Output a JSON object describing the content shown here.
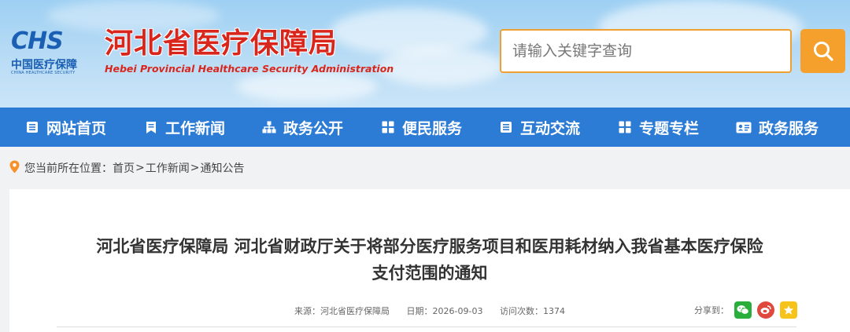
{
  "header": {
    "logo_letters": "CHS",
    "logo_cn": "中国医疗保障",
    "logo_en": "CHINA HEALTHCARE SECURITY",
    "site_title": "河北省医疗保障局",
    "site_subtitle": "Hebei Provincial Healthcare Security Administration",
    "search_placeholder": "请输入关键字查询",
    "search_icon": "search-icon"
  },
  "nav": {
    "items": [
      {
        "label": "网站首页",
        "icon": "list-icon"
      },
      {
        "label": "工作新闻",
        "icon": "bookmark-icon"
      },
      {
        "label": "政务公开",
        "icon": "org-chart-icon"
      },
      {
        "label": "便民服务",
        "icon": "grid-icon"
      },
      {
        "label": "互动交流",
        "icon": "list-icon"
      },
      {
        "label": "专题专栏",
        "icon": "grid-icon"
      },
      {
        "label": "政务服务",
        "icon": "id-card-icon"
      }
    ]
  },
  "breadcrumb": {
    "prefix": "您当前所在位置：",
    "items": [
      "首页",
      "工作新闻",
      "通知公告"
    ],
    "separator": ">"
  },
  "article": {
    "title_line1": "河北省医疗保障局 河北省财政厅关于将部分医疗服务项目和医用耗材纳入我省基本医疗保险",
    "title_line2": "支付范围的通知",
    "source_label": "来源：",
    "source_value": "河北省医疗保障局",
    "date_label": "日期：",
    "date_value": "2026-09-03",
    "views_label": "访问次数：",
    "views_value": "1374",
    "share_label": "分享到："
  },
  "colors": {
    "nav_bg": "#2c7bd4",
    "title_red": "#d9261c",
    "search_orange": "#f5a02d",
    "wechat_green": "#2aae3b",
    "weibo_red": "#e0483d",
    "qzone_yellow": "#f5c31a"
  }
}
